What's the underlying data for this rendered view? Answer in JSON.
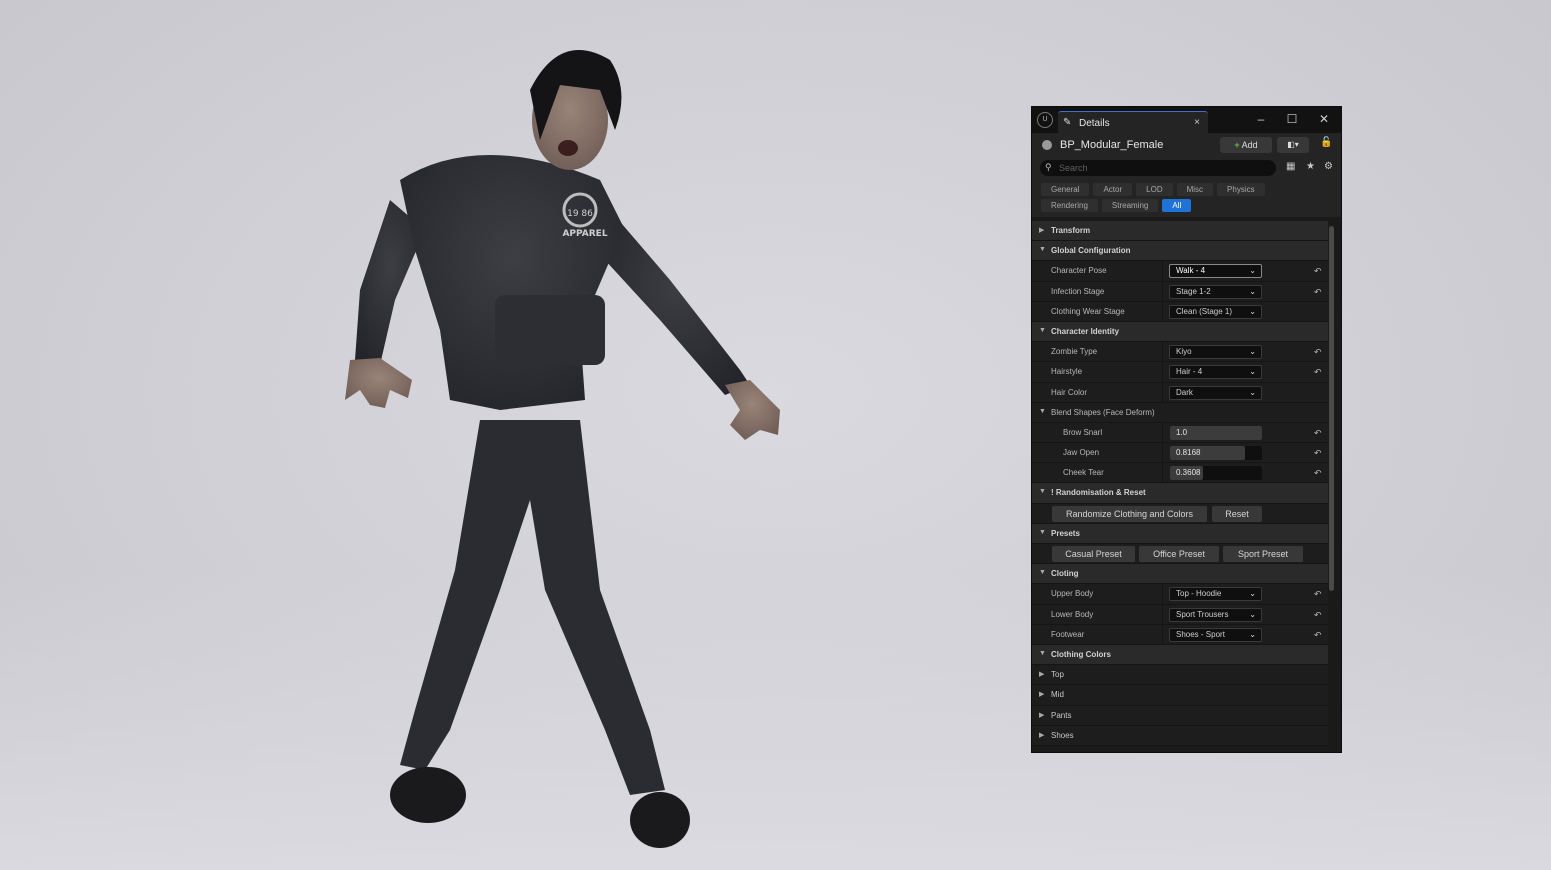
{
  "window": {
    "tab_label": "Details",
    "tab_close": "×",
    "minimize": "–",
    "maximize": "☐",
    "close": "✕",
    "logo": "U"
  },
  "object": {
    "name": "BP_Modular_Female",
    "add_label": "Add",
    "add_plus": "+",
    "blueprint_icon": "◧▾",
    "lock_icon": "🔓"
  },
  "search": {
    "placeholder": "Search",
    "icon": "⚲",
    "table_icon": "▦",
    "favorite_icon": "★",
    "settings_icon": "⚙"
  },
  "filters": {
    "row1": [
      "General",
      "Actor",
      "LOD",
      "Misc",
      "Physics"
    ],
    "row2": [
      "Rendering",
      "Streaming",
      "All"
    ],
    "active": "All"
  },
  "sections": {
    "transform": "Transform",
    "global_configuration": "Global Configuration",
    "character_identity": "Character Identity",
    "blend_shapes": "Blend Shapes (Face Deform)",
    "randomisation": "! Randomisation & Reset",
    "presets": "Presets",
    "clothing": "Cloting",
    "clothing_colors": "Clothing Colors"
  },
  "properties": {
    "character_pose": {
      "label": "Character Pose",
      "value": "Walk - 4"
    },
    "infection_stage": {
      "label": "Infection Stage",
      "value": "Stage 1-2"
    },
    "clothing_wear_stage": {
      "label": "Clothing Wear Stage",
      "value": "Clean (Stage 1)"
    },
    "zombie_type": {
      "label": "Zombie Type",
      "value": "Kiyo"
    },
    "hairstyle": {
      "label": "Hairstyle",
      "value": "Hair - 4"
    },
    "hair_color": {
      "label": "Hair Color",
      "value": "Dark"
    },
    "brow_snarl": {
      "label": "Brow Snarl",
      "value": "1.0",
      "fraction": 1.0
    },
    "jaw_open": {
      "label": "Jaw Open",
      "value": "0.8168",
      "fraction": 0.8168
    },
    "cheek_tear": {
      "label": "Cheek Tear",
      "value": "0.3608",
      "fraction": 0.3608
    },
    "upper_body": {
      "label": "Upper Body",
      "value": "Top - Hoodie"
    },
    "lower_body": {
      "label": "Lower Body",
      "value": "Sport Trousers"
    },
    "footwear": {
      "label": "Footwear",
      "value": "Shoes - Sport"
    }
  },
  "buttons": {
    "randomize": "Randomize Clothing and Colors",
    "reset": "Reset",
    "casual_preset": "Casual Preset",
    "office_preset": "Office Preset",
    "sport_preset": "Sport Preset"
  },
  "color_groups": [
    "Top",
    "Mid",
    "Pants",
    "Shoes"
  ],
  "glyphs": {
    "collapsed": "▶",
    "expanded": "▼",
    "chevron": "⌄",
    "reset": "↶"
  },
  "viewport": {
    "hoodie_print_top": "APPAREL",
    "hoodie_print_numbers": "19   86"
  },
  "colors": {
    "accent": "#1f72d6",
    "panel_bg": "#1a1a1a"
  }
}
